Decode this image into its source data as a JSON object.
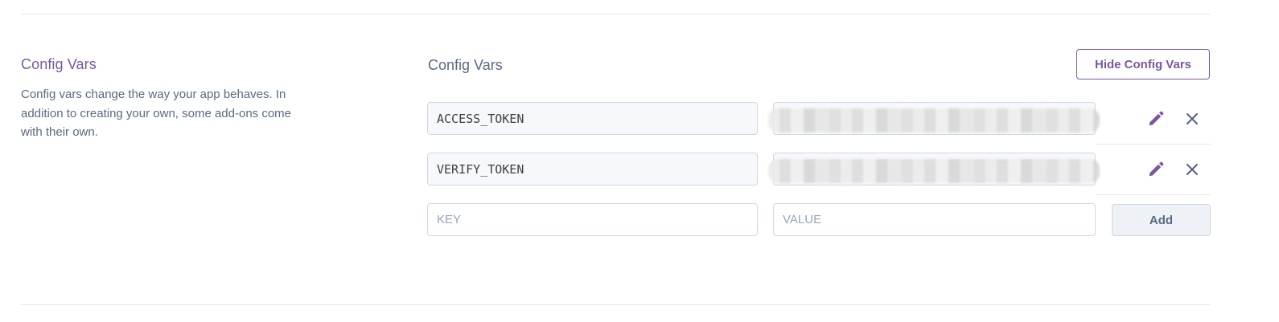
{
  "section": {
    "title": "Config Vars",
    "description": "Config vars change the way your app behaves. In addition to creating your own, some add-ons come with their own."
  },
  "panel": {
    "title": "Config Vars",
    "hide_button_label": "Hide Config Vars"
  },
  "config_vars": [
    {
      "key": "ACCESS_TOKEN",
      "value": "",
      "value_obscured": true
    },
    {
      "key": "VERIFY_TOKEN",
      "value": "",
      "value_obscured": true
    }
  ],
  "new_var": {
    "key_placeholder": "KEY",
    "value_placeholder": "VALUE",
    "add_button_label": "Add"
  },
  "icons": {
    "edit": "pencil-icon",
    "delete": "close-icon"
  },
  "colors": {
    "accent": "#79589f",
    "text_muted": "#596981",
    "border": "#cfd7e6",
    "field_bg": "#f7f8fb"
  }
}
